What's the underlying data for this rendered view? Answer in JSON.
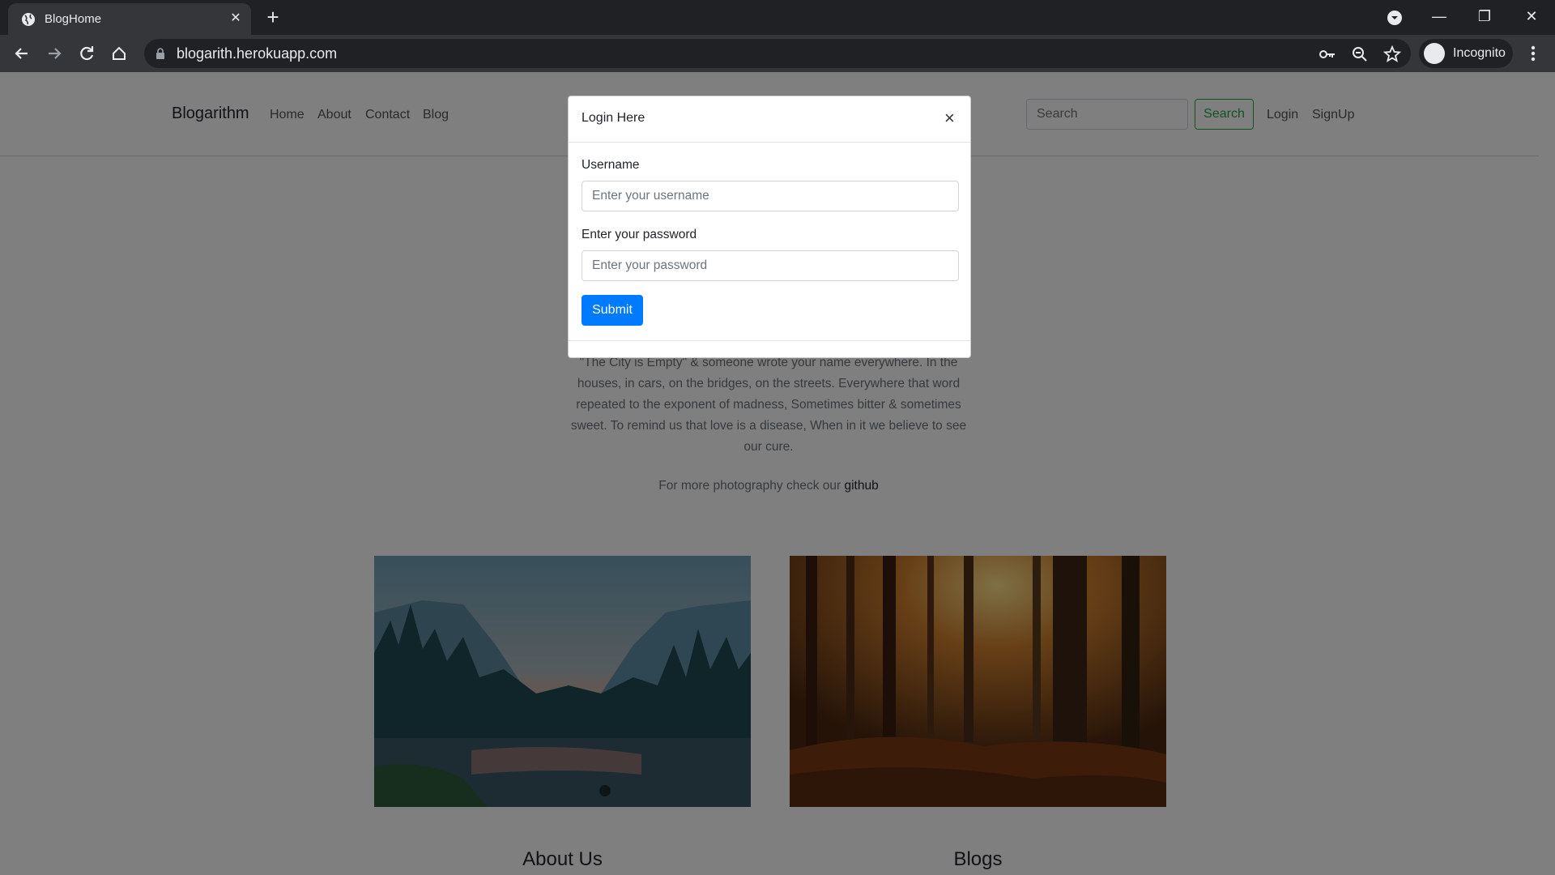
{
  "browser": {
    "tab_title": "BlogHome",
    "tab_close": "✕",
    "new_tab": "+",
    "url": "blogarith.herokuapp.com",
    "profile_label": "Incognito",
    "minimize": "—",
    "restore": "❐",
    "close": "✕"
  },
  "navbar": {
    "brand": "Blogarithm",
    "links": [
      "Home",
      "About",
      "Contact",
      "Blog"
    ],
    "search_placeholder": "Search",
    "search_button": "Search",
    "login": "Login",
    "signup": "SignUp"
  },
  "hero": {
    "quote": "\"The City is Empty\" & someone wrote your name everywhere. In the houses, in cars, on the bridges, on the streets. Everywhere that word repeated to the exponent of madness, Sometimes bitter & sometimes sweet. To remind us that love is a disease, When in it we believe to see our cure.",
    "more_text": "For more photography check our ",
    "more_link": "github"
  },
  "sections": {
    "about_title": "About Us",
    "blogs_title": "Blogs"
  },
  "modal": {
    "title": "Login Here",
    "close": "×",
    "username_label": "Username",
    "username_placeholder": "Enter your username",
    "password_label": "Enter your password",
    "password_placeholder": "Enter your password",
    "submit": "Submit"
  },
  "colors": {
    "chrome_dark": "#202124",
    "chrome_toolbar": "#35363a",
    "primary": "#007bff",
    "success": "#28a745"
  }
}
